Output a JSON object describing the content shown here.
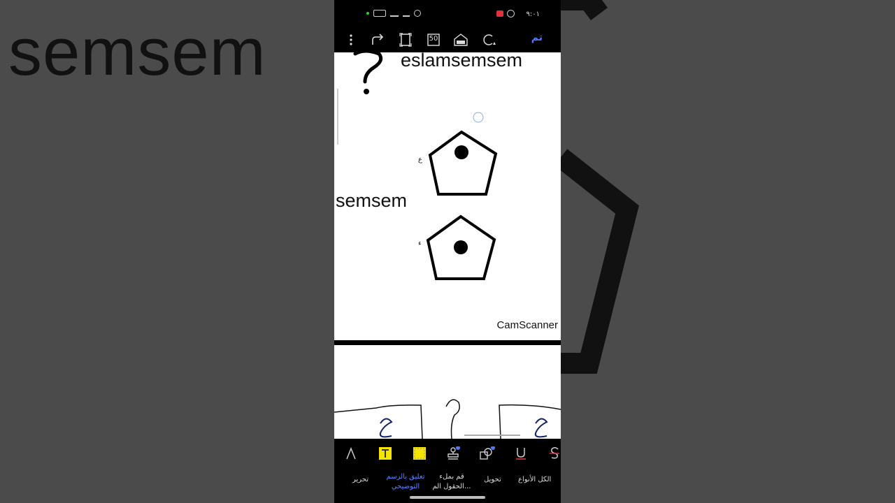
{
  "background": {
    "zoom_text": "semsem"
  },
  "status_bar": {
    "time": "٩:٠١"
  },
  "toolbar": {
    "page_count": "50",
    "done_label": "تم"
  },
  "document": {
    "page1": {
      "top_text": "eslamsemsem",
      "mid_text": "semsem",
      "footer_text": "CamScanner",
      "mark_1": "ع",
      "mark_2": "ء"
    }
  },
  "bottom_toolbar": {
    "labels": [
      {
        "id": "edit",
        "text": "تحرير"
      },
      {
        "id": "annotate",
        "text": "تعليق بالرسم التوضيحي"
      },
      {
        "id": "fill",
        "text": "قم بملء الحقول الم..."
      },
      {
        "id": "convert",
        "text": "تحويل"
      },
      {
        "id": "all",
        "text": "الكل الأنواع"
      }
    ]
  },
  "colors": {
    "accent": "#4d79ff",
    "highlight_yellow": "#f5e400"
  }
}
